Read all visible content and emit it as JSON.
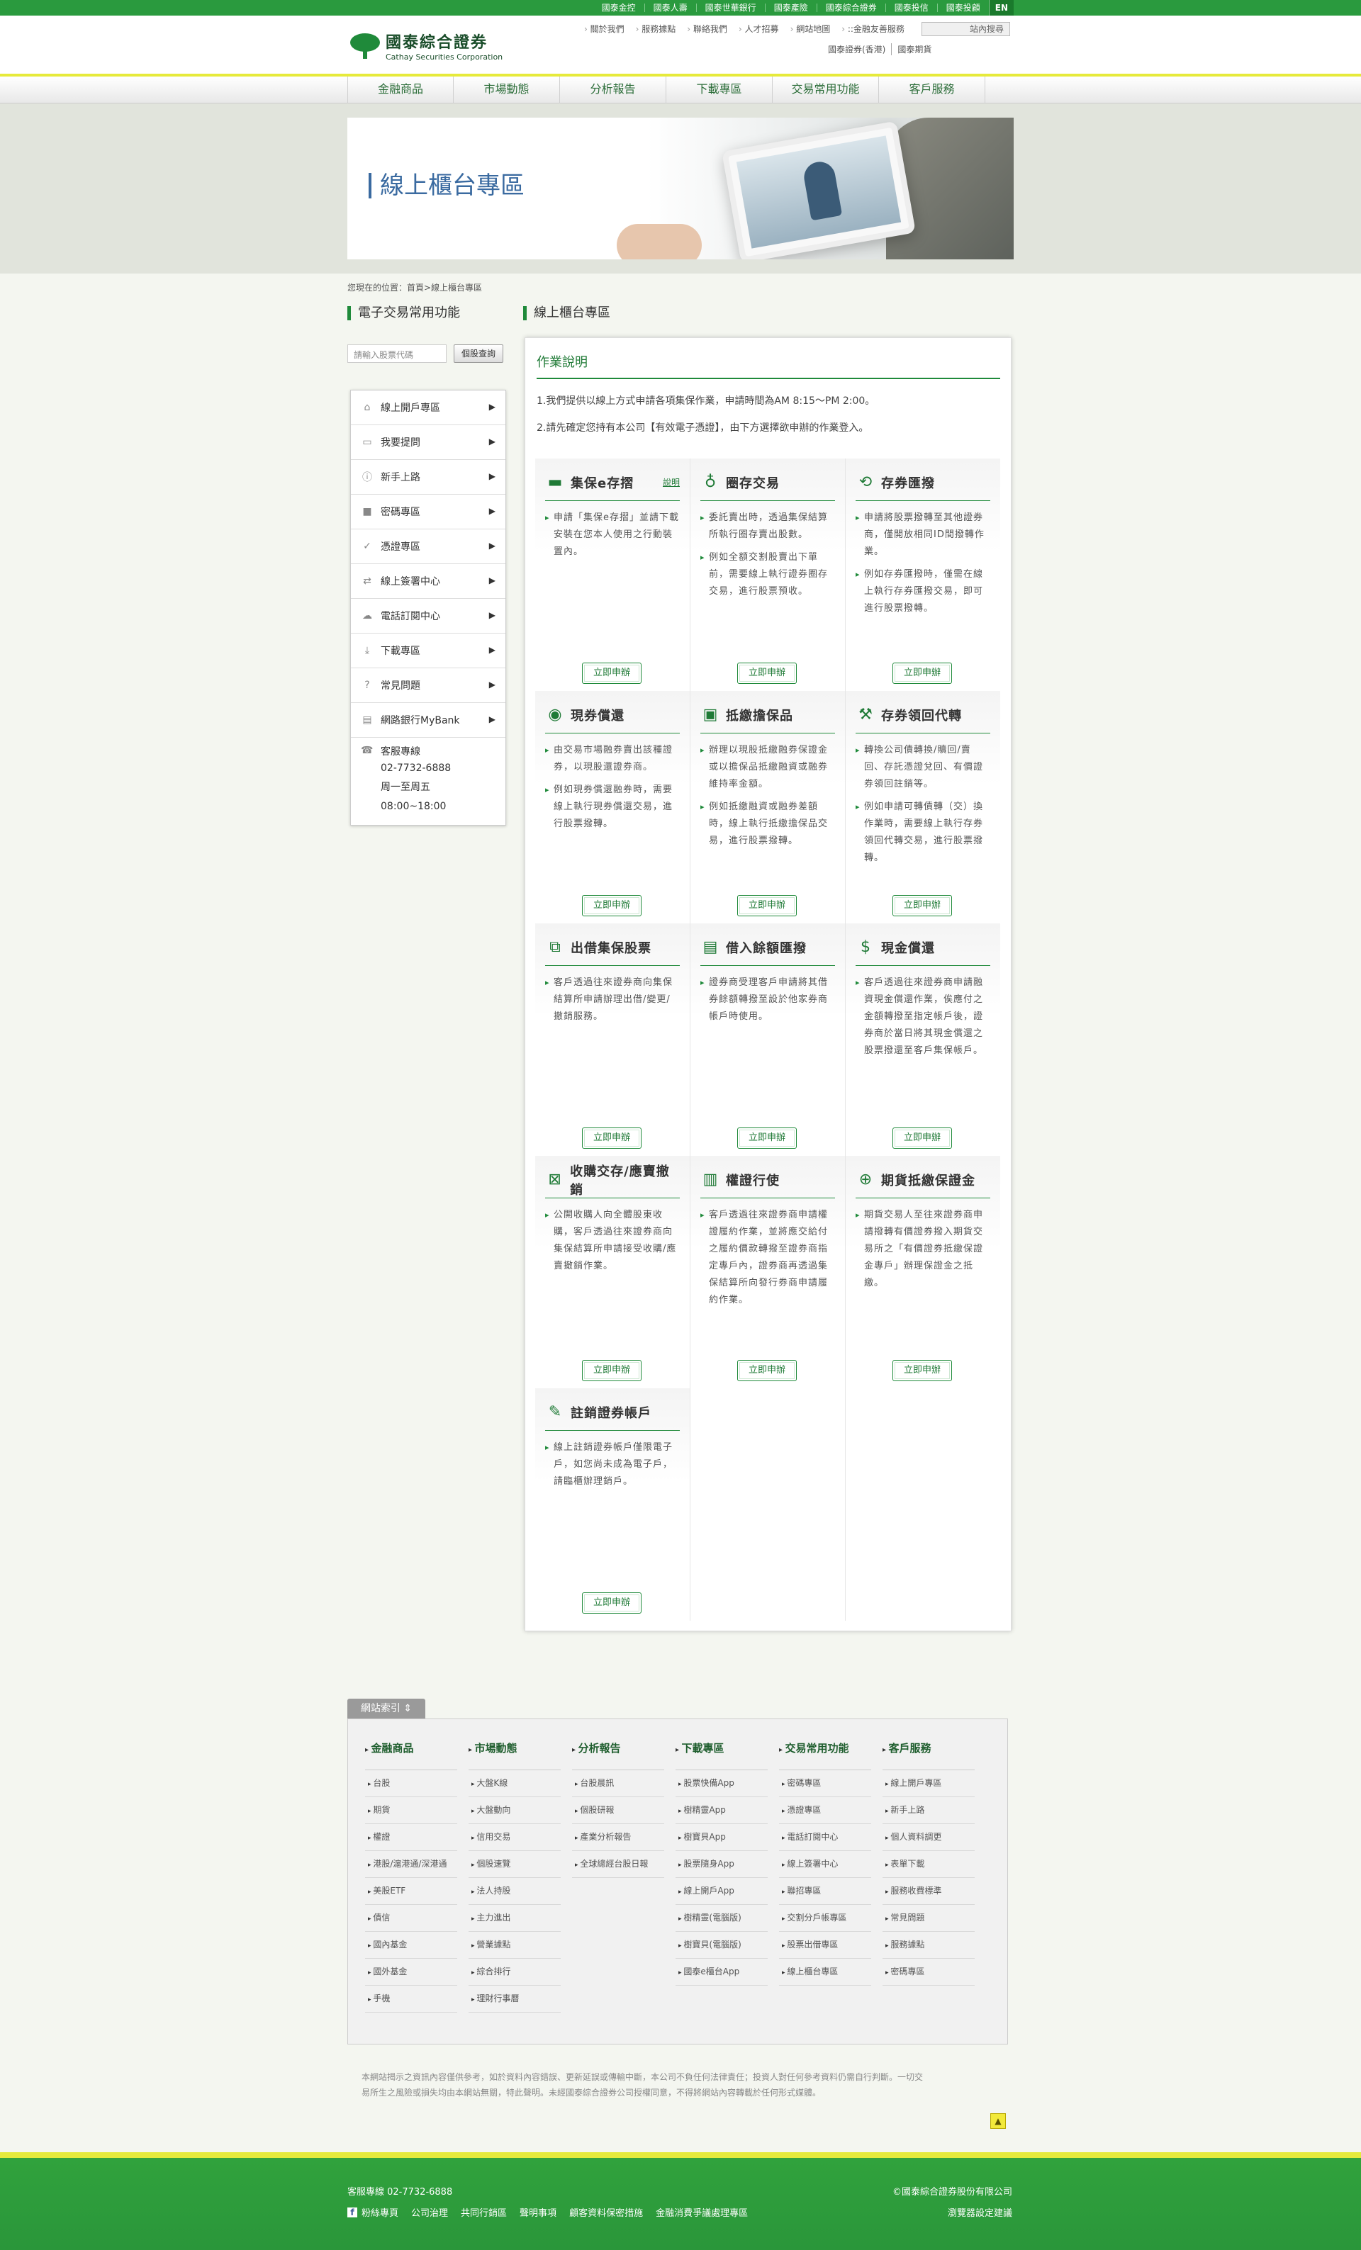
{
  "topbar": {
    "links": [
      "國泰金控",
      "國泰人壽",
      "國泰世華銀行",
      "國泰產險",
      "國泰綜合證券",
      "國泰投信",
      "國泰投顧"
    ],
    "lang": "EN"
  },
  "header": {
    "logo_zh": "國泰綜合證券",
    "logo_en": "Cathay Securities Corporation",
    "links": [
      "關於我們",
      "服務據點",
      "聯絡我們",
      "人才招募",
      "網站地圖",
      "::金融友善服務"
    ],
    "search_placeholder": "站內搜尋",
    "links2": [
      "國泰證券(香港)",
      "國泰期貨"
    ]
  },
  "nav": [
    "金融商品",
    "市場動態",
    "分析報告",
    "下載專區",
    "交易常用功能",
    "客戶服務"
  ],
  "banner": {
    "title": "線上櫃台專區"
  },
  "breadcrumb": "您現在的位置：首頁>線上櫃台專區",
  "sidebar": {
    "title": "電子交易常用功能",
    "stock_placeholder": "請輸入股票代碼",
    "stock_button": "個股查詢",
    "items": [
      {
        "label": "線上開戶專區",
        "icon": "home-icon"
      },
      {
        "label": "我要提問",
        "icon": "chat-icon"
      },
      {
        "label": "新手上路",
        "icon": "info-icon"
      },
      {
        "label": "密碼專區",
        "icon": "lock-icon"
      },
      {
        "label": "憑證專區",
        "icon": "check-icon"
      },
      {
        "label": "線上簽署中心",
        "icon": "exchange-icon"
      },
      {
        "label": "電話訂閱中心",
        "icon": "cloud-icon"
      },
      {
        "label": "下載專區",
        "icon": "download-icon"
      },
      {
        "label": "常見問題",
        "icon": "question-icon"
      },
      {
        "label": "網路銀行MyBank",
        "icon": "printer-icon"
      }
    ],
    "service": {
      "label": "客服專線",
      "phone": "02-7732-6888",
      "days": "周一至周五",
      "hours": "08:00~18:00"
    }
  },
  "main": {
    "section_title": "線上櫃台專區",
    "panel_title": "作業說明",
    "intro1": "1.我們提供以線上方式申請各項集保作業，申請時間為AM 8:15～PM 2:00。",
    "intro2": "2.請先確定您持有本公司【有效電子憑證】，由下方選擇欲申辦的作業登入。",
    "apply_label": "立即申辦",
    "explain_label": "說明",
    "cards": [
      {
        "title": "集保e存摺",
        "icon": "passbook-icon",
        "desc": [
          "申請「集保e存摺」並請下載安裝在您本人使用之行動裝置內。"
        ]
      },
      {
        "title": "圈存交易",
        "icon": "stock-icon",
        "desc": [
          "委託賣出時，透過集保結算所執行圈存賣出股數。",
          "例如全額交割股賣出下單前，需要線上執行證券圈存交易，進行股票預收。"
        ]
      },
      {
        "title": "存券匯撥",
        "icon": "transfer-icon",
        "desc": [
          "申請將股票撥轉至其他證券商，僅開放相同ID間撥轉作業。",
          "例如存券匯撥時，僅需在線上執行存券匯撥交易，即可進行股票撥轉。"
        ]
      },
      {
        "title": "現券償還",
        "icon": "coin-icon",
        "desc": [
          "由交易市場融券賣出該種證券，以現股還證券商。",
          "例如現券償還融券時，需要線上執行現券償還交易，進行股票撥轉。"
        ]
      },
      {
        "title": "抵繳擔保品",
        "icon": "collateral-icon",
        "desc": [
          "辦理以現股抵繳融券保證金或以擔保品抵繳融資或融券維持率金額。",
          "例如抵繳融資或融券差額時，線上執行抵繳擔保品交易，進行股票撥轉。"
        ]
      },
      {
        "title": "存券領回代轉",
        "icon": "hammer-icon",
        "desc": [
          "轉換公司債轉換/贖回/賣回、存託憑證兌回、有價證券領回註銷等。",
          "例如申請可轉債轉（交）換作業時，需要線上執行存券領回代轉交易，進行股票撥轉。"
        ]
      },
      {
        "title": "出借集保股票",
        "icon": "lending-icon",
        "desc": [
          "客戶透過往來證券商向集保結算所申請辦理出借/變更/撤銷服務。"
        ]
      },
      {
        "title": "借入餘額匯撥",
        "icon": "borrow-icon",
        "desc": [
          "證券商受理客戶申請將其借券餘額轉撥至設於他家券商帳戶時使用。"
        ]
      },
      {
        "title": "現金償還",
        "icon": "cash-icon",
        "desc": [
          "客戶透過往來證券商申請融資現金償還作業，俟應付之金額轉撥至指定帳戶後，證券商於當日將其現金償還之股票撥還至客戶集保帳戶。"
        ]
      },
      {
        "title": "收購交存/應賣撤銷",
        "icon": "grid-icon",
        "desc": [
          "公開收購人向全體股東收購，客戶透過往來證券商向集保結算所申請接受收購/應賣撤銷作業。"
        ]
      },
      {
        "title": "權證行使",
        "icon": "warrant-icon",
        "desc": [
          "客戶透過往來證券商申請權證履約作業，並將應交給付之履約價款轉撥至證券商指定專戶內，證券商再透過集保結算所向發行券商申請履約作業。"
        ]
      },
      {
        "title": "期貨抵繳保證金",
        "icon": "futures-icon",
        "desc": [
          "期貨交易人至往來證券商申請撥轉有價證券撥入期貨交易所之「有價證券抵繳保證金專戶」辦理保證金之抵繳。"
        ]
      },
      {
        "title": "註銷證券帳戶",
        "icon": "cancel-icon",
        "desc": [
          "線上註銷證券帳戶僅限電子戶，如您尚未成為電子戶，請臨櫃辦理銷戶。"
        ]
      }
    ]
  },
  "sitemap": {
    "tab": "網站索引",
    "columns": [
      {
        "title": "金融商品",
        "items": [
          "台股",
          "期貨",
          "權證",
          "港股/滬港通/深港通",
          "美股ETF",
          "債信",
          "國內基金",
          "國外基金",
          "手機"
        ]
      },
      {
        "title": "市場動態",
        "items": [
          "大盤K線",
          "大盤動向",
          "信用交易",
          "個股速覽",
          "法人持股",
          "主力進出",
          "營業據點",
          "綜合排行",
          "理財行事曆"
        ]
      },
      {
        "title": "分析報告",
        "items": [
          "台股晨訊",
          "個股研報",
          "產業分析報告",
          "全球總經台股日報"
        ]
      },
      {
        "title": "下載專區",
        "items": [
          "股票快備App",
          "樹精靈App",
          "樹寶貝App",
          "股票隨身App",
          "線上開戶App",
          "樹精靈(電腦版)",
          "樹寶貝(電腦版)",
          "國泰e櫃台App"
        ]
      },
      {
        "title": "交易常用功能",
        "items": [
          "密碼專區",
          "憑證專區",
          "電話訂閱中心",
          "線上簽署中心",
          "聯招專區",
          "交割分戶帳專區",
          "股票出借專區",
          "線上櫃台專區"
        ]
      },
      {
        "title": "客戶服務",
        "items": [
          "線上開戶專區",
          "新手上路",
          "個人資料調更",
          "表單下載",
          "服務收費標準",
          "常見問題",
          "服務據點",
          "密碼專區"
        ]
      }
    ]
  },
  "disclaimer": "本網站揭示之資訊內容僅供參考，如於資料內容錯誤、更新延誤或傳輸中斷，本公司不負任何法律責任；投資人對任何參考資料仍需自行判斷。一切交易所生之風險或損失均由本網站無關，特此聲明。未經國泰綜合證券公司授權同意，不得將網站內容轉載於任何形式媒體。",
  "footer": {
    "phone": "客服專線 02-7732-6888",
    "links": [
      "粉絲專頁",
      "公司治理",
      "共同行銷區",
      "聲明事項",
      "顧客資料保密措施",
      "金融消費爭議處理專區"
    ],
    "copyright": "©國泰綜合證券股份有限公司",
    "browser": "瀏覽器設定建議"
  }
}
